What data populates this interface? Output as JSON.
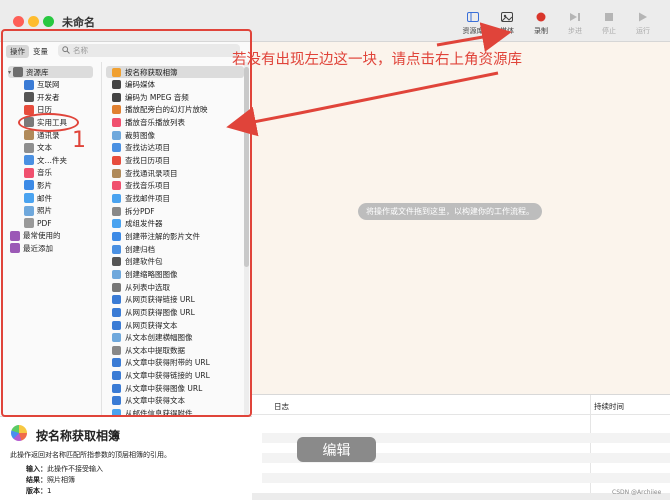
{
  "window": {
    "title": "未命名"
  },
  "toolbar": {
    "items": [
      {
        "label": "资源库",
        "icon": "library-icon",
        "disabled": false
      },
      {
        "label": "媒体",
        "icon": "media-icon",
        "disabled": false
      },
      {
        "label": "录制",
        "icon": "record-icon",
        "disabled": false
      },
      {
        "label": "步进",
        "icon": "step-icon",
        "disabled": true
      },
      {
        "label": "停止",
        "icon": "stop-icon",
        "disabled": true
      },
      {
        "label": "运行",
        "icon": "run-icon",
        "disabled": true
      }
    ]
  },
  "library": {
    "tabs": [
      {
        "label": "操作",
        "active": true
      },
      {
        "label": "变量",
        "active": false
      }
    ],
    "search_placeholder": "名称",
    "categories": [
      {
        "label": "资源库",
        "level": 0,
        "root": true,
        "color": "#6d6d6d"
      },
      {
        "label": "互联网",
        "level": 1,
        "color": "#3a7bd5"
      },
      {
        "label": "开发者",
        "level": 1,
        "color": "#555555"
      },
      {
        "label": "日历",
        "level": 1,
        "color": "#e74c3c"
      },
      {
        "label": "实用工具",
        "level": 1,
        "color": "#7a7a7a"
      },
      {
        "label": "通讯录",
        "level": 1,
        "color": "#b08a5a"
      },
      {
        "label": "文本",
        "level": 1,
        "color": "#8e8e8e"
      },
      {
        "label": "文…件夹",
        "level": 1,
        "color": "#4a90e2"
      },
      {
        "label": "音乐",
        "level": 1,
        "color": "#f0506e"
      },
      {
        "label": "影片",
        "level": 1,
        "color": "#3c8ae6"
      },
      {
        "label": "邮件",
        "level": 1,
        "color": "#4aa3f0"
      },
      {
        "label": "照片",
        "level": 1,
        "color": "#6fa8dc"
      },
      {
        "label": "PDF",
        "level": 1,
        "color": "#999999"
      },
      {
        "label": "最常使用的",
        "level": 0,
        "color": "#9b59b6"
      },
      {
        "label": "最近添加",
        "level": 0,
        "color": "#9b59b6"
      }
    ],
    "actions": [
      {
        "label": "按名称获取相簿",
        "selected": true,
        "color": "#f0a030"
      },
      {
        "label": "编码媒体",
        "color": "#444444"
      },
      {
        "label": "编码为 MPEG 音频",
        "color": "#444444"
      },
      {
        "label": "播放配旁白的幻灯片放映",
        "color": "#e08030"
      },
      {
        "label": "播放音乐播放列表",
        "color": "#f0506e"
      },
      {
        "label": "裁剪图像",
        "color": "#6fa8dc"
      },
      {
        "label": "查找访达项目",
        "color": "#4a90e2"
      },
      {
        "label": "查找日历项目",
        "color": "#e74c3c"
      },
      {
        "label": "查找通讯录项目",
        "color": "#b08a5a"
      },
      {
        "label": "查找音乐项目",
        "color": "#f0506e"
      },
      {
        "label": "查找邮件项目",
        "color": "#4aa3f0"
      },
      {
        "label": "拆分PDF",
        "color": "#888888"
      },
      {
        "label": "成组发件器",
        "color": "#4aa3f0"
      },
      {
        "label": "创建带注解的影片文件",
        "color": "#3c8ae6"
      },
      {
        "label": "创建归档",
        "color": "#4a90e2"
      },
      {
        "label": "创建软件包",
        "color": "#555555"
      },
      {
        "label": "创建缩略图图像",
        "color": "#6fa8dc"
      },
      {
        "label": "从列表中选取",
        "color": "#777777"
      },
      {
        "label": "从网页获得链接 URL",
        "color": "#3a7bd5"
      },
      {
        "label": "从网页获得图像 URL",
        "color": "#3a7bd5"
      },
      {
        "label": "从网页获得文本",
        "color": "#3a7bd5"
      },
      {
        "label": "从文本创建横幅图像",
        "color": "#6fa8dc"
      },
      {
        "label": "从文本中提取数据",
        "color": "#888888"
      },
      {
        "label": "从文章中获得附带的 URL",
        "color": "#3a7bd5"
      },
      {
        "label": "从文章中获得链接的 URL",
        "color": "#3a7bd5"
      },
      {
        "label": "从文章中获得图像 URL",
        "color": "#3a7bd5"
      },
      {
        "label": "从文章中获得文本",
        "color": "#3a7bd5"
      },
      {
        "label": "从邮件信息获得附件",
        "color": "#4aa3f0"
      }
    ]
  },
  "workflow": {
    "hint": "将操作或文件拖到这里，以构建你的工作流程。"
  },
  "log": {
    "col_log": "日志",
    "col_time": "持续时间"
  },
  "description": {
    "title": "按名称获取相簿",
    "text": "此操作返回对名称匹配所指参数的顶层相簿的引用。",
    "input_label": "输入：",
    "input_value": "此操作不接受输入",
    "result_label": "结果：",
    "result_value": "照片相簿",
    "version_label": "版本：",
    "version_value": "1"
  },
  "annotations": {
    "instruction": "若没有出现左边这一块，请点击右上角资源库",
    "number": "1",
    "edit_label": "编辑",
    "accent": "#e0443a"
  },
  "watermark": "CSDN @Archiiee"
}
